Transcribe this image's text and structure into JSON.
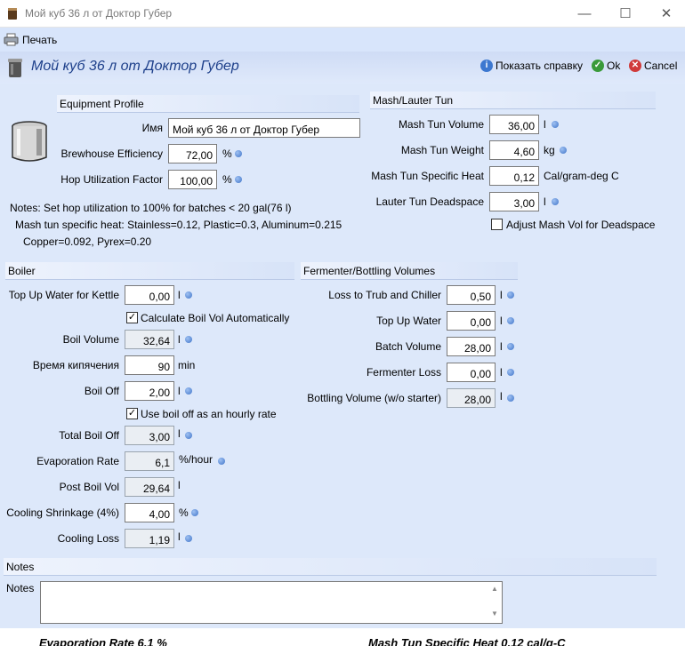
{
  "window": {
    "title": "Мой куб 36 л от Доктор Губер",
    "minimize": "—",
    "maximize": "☐",
    "close": "✕"
  },
  "toolbar": {
    "print_label": "Печать"
  },
  "header": {
    "title": "Мой куб 36 л от Доктор Губер",
    "help_label": "Показать справку",
    "ok_label": "Ok",
    "cancel_label": "Cancel"
  },
  "equipment": {
    "section_title": "Equipment Profile",
    "name_label": "Имя",
    "name_value": "Мой куб 36 л от Доктор Губер",
    "efficiency_label": "Brewhouse Efficiency",
    "efficiency_value": "72,00",
    "efficiency_unit": "%",
    "hop_label": "Hop Utilization Factor",
    "hop_value": "100,00",
    "hop_unit": "%",
    "note1": "Notes: Set hop utilization to 100% for batches < 20 gal(76 l)",
    "note2": "Mash tun specific heat: Stainless=0.12, Plastic=0.3, Aluminum=0.215",
    "note3": "Copper=0.092, Pyrex=0.20"
  },
  "mash": {
    "section_title": "Mash/Lauter Tun",
    "volume_label": "Mash Tun Volume",
    "volume_value": "36,00",
    "volume_unit": "l",
    "weight_label": "Mash Tun Weight",
    "weight_value": "4,60",
    "weight_unit": "kg",
    "heat_label": "Mash Tun Specific Heat",
    "heat_value": "0,12",
    "heat_unit": "Cal/gram-deg C",
    "deadspace_label": "Lauter Tun Deadspace",
    "deadspace_value": "3,00",
    "deadspace_unit": "l",
    "adjust_label": "Adjust Mash Vol for Deadspace",
    "adjust_checked": ""
  },
  "boiler": {
    "section_title": "Boiler",
    "topup_label": "Top Up Water for Kettle",
    "topup_value": "0,00",
    "topup_unit": "l",
    "calc_label": "Calculate Boil Vol Automatically",
    "calc_checked": "✓",
    "boilvol_label": "Boil Volume",
    "boilvol_value": "32,64",
    "boilvol_unit": "l",
    "boiltime_label": "Время кипячения",
    "boiltime_value": "90",
    "boiltime_unit": "min",
    "boiloff_label": "Boil Off",
    "boiloff_value": "2,00",
    "boiloff_unit": "l",
    "hourly_label": "Use boil off as an hourly rate",
    "hourly_checked": "✓",
    "total_label": "Total Boil Off",
    "total_value": "3,00",
    "total_unit": "l",
    "evap_label": "Evaporation Rate",
    "evap_value": "6,1",
    "evap_unit": "%/hour",
    "post_label": "Post Boil Vol",
    "post_value": "29,64",
    "post_unit": "l",
    "cooling_label": "Cooling Shrinkage (4%)",
    "cooling_value": "4,00",
    "cooling_unit": "%",
    "coolloss_label": "Cooling Loss",
    "coolloss_value": "1,19",
    "coolloss_unit": "l"
  },
  "fermenter": {
    "section_title": "Fermenter/Bottling Volumes",
    "trub_label": "Loss to Trub and Chiller",
    "trub_value": "0,50",
    "trub_unit": "l",
    "topup_label": "Top Up Water",
    "topup_value": "0,00",
    "topup_unit": "l",
    "batch_label": "Batch Volume",
    "batch_value": "28,00",
    "batch_unit": "l",
    "loss_label": "Fermenter Loss",
    "loss_value": "0,00",
    "loss_unit": "l",
    "bottling_label": "Bottling Volume (w/o starter)",
    "bottling_value": "28,00",
    "bottling_unit": "l"
  },
  "notes": {
    "section_title": "Notes",
    "label": "Notes",
    "value": ""
  },
  "footer_fragment": {
    "left": "Evaporation Rate 6,1 %",
    "right": "Mash Tun Specific Heat 0,12 cal/g-C"
  }
}
